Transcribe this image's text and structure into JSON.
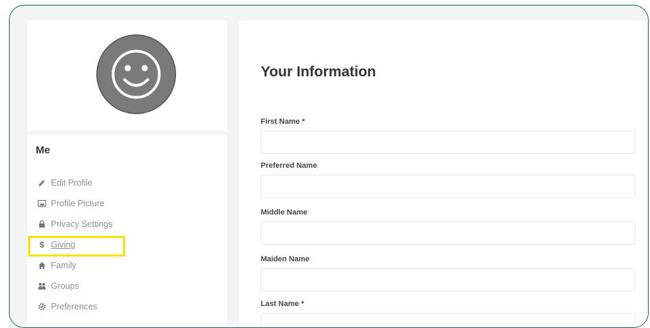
{
  "profile": {
    "avatar_icon": "smiley-face-icon"
  },
  "sidebar": {
    "section_title": "Me",
    "items": [
      {
        "label": "Edit Profile",
        "icon": "pencil-icon"
      },
      {
        "label": "Profile Picture",
        "icon": "picture-icon"
      },
      {
        "label": "Privacy Settings",
        "icon": "lock-icon"
      },
      {
        "label": "Giving",
        "icon": "dollar-icon"
      },
      {
        "label": "Family",
        "icon": "home-icon"
      },
      {
        "label": "Groups",
        "icon": "group-icon"
      },
      {
        "label": "Preferences",
        "icon": "gear-icon"
      }
    ],
    "highlight_color": "#f4e600"
  },
  "main": {
    "title": "Your Information",
    "fields": [
      {
        "label": "First Name *",
        "value": ""
      },
      {
        "label": "Preferred Name",
        "value": ""
      },
      {
        "label": "Middle Name",
        "value": ""
      },
      {
        "label": "Maiden Name",
        "value": ""
      },
      {
        "label": "Last Name *",
        "value": ""
      }
    ]
  },
  "colors": {
    "frame_border": "#1f5f66",
    "avatar": "#7a7a7a"
  }
}
